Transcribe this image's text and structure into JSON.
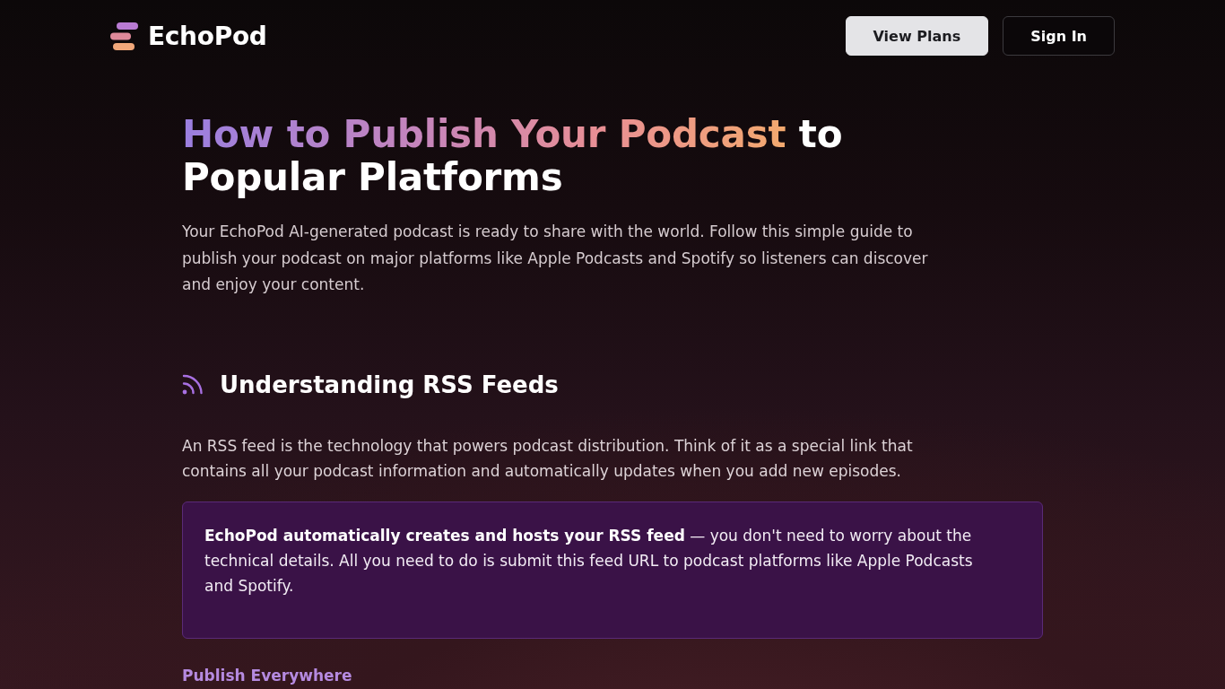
{
  "header": {
    "logo": "EchoPod",
    "buttons": [
      {
        "label": "View Plans",
        "kind": "primary"
      },
      {
        "label": "Sign In",
        "kind": "outline"
      }
    ]
  },
  "hero": {
    "title_highlight": "How to Publish Your Podcast",
    "title_rest": "to Popular Platforms",
    "intro": "Your EchoPod AI-generated podcast is ready to share with the world. Follow this simple guide to publish your podcast on major platforms like Apple Podcasts and Spotify so listeners can discover and enjoy your content."
  },
  "sections": [
    {
      "heading": "Understanding RSS Feeds",
      "paragraphs": [
        "An RSS feed is the technology that powers podcast distribution. Think of it as a special link that contains all your podcast information and automatically updates when you add new episodes."
      ],
      "callout": "**EchoPod automatically creates and hosts your RSS feed** — you don't need to worry about the technical details. All you need to do is submit this feed URL to podcast platforms like Apple Podcasts and Spotify."
    }
  ],
  "next_section_eyebrow": "Publish Everywhere"
}
